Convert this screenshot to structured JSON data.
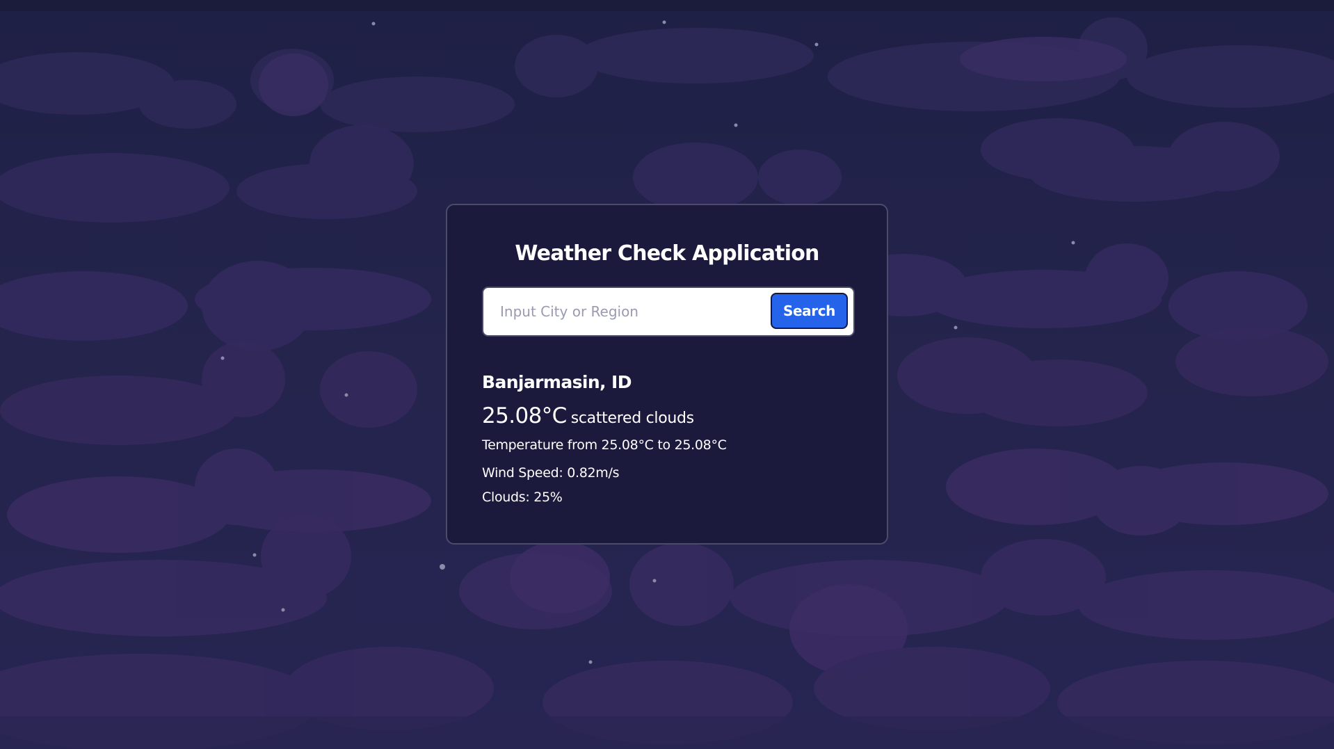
{
  "app": {
    "title": "Weather Check Application"
  },
  "search": {
    "placeholder": "Input City or Region",
    "value": "",
    "button_label": "Search"
  },
  "weather": {
    "location": "Banjarmasin, ID",
    "temperature": "25.08°C",
    "description": "scattered clouds",
    "range": "Temperature from 25.08°C to 25.08°C",
    "wind": "Wind Speed: 0.82m/s",
    "clouds": "Clouds: 25%"
  },
  "colors": {
    "background": "#222349",
    "cloud": "#3a2d5e",
    "card": "#1b1a3c",
    "card_border": "#4b4b6a",
    "button": "#2563eb",
    "text": "#ffffff",
    "placeholder": "#9a9ab0"
  }
}
